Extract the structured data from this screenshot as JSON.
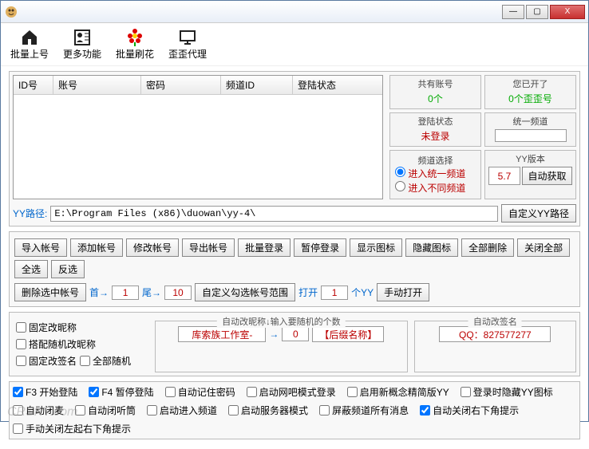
{
  "window": {
    "min": "—",
    "max": "▢",
    "close": "X"
  },
  "toolbar": [
    {
      "label": "批量上号",
      "icon": "home"
    },
    {
      "label": "更多功能",
      "icon": "user"
    },
    {
      "label": "批量刷花",
      "icon": "flower"
    },
    {
      "label": "歪歪代理",
      "icon": "monitor"
    }
  ],
  "table": {
    "cols": [
      "ID号",
      "账号",
      "密码",
      "频道ID",
      "登陆状态"
    ]
  },
  "stats": {
    "total_label": "共有账号",
    "total_val": "0个",
    "opened_label": "您已开了",
    "opened_val": "0个歪歪号",
    "login_label": "登陆状态",
    "login_val": "未登录",
    "channel_label": "统一频道",
    "channel_val": ""
  },
  "channel_select": {
    "legend": "频道选择",
    "same": "进入统一频道",
    "diff": "进入不同频道"
  },
  "version": {
    "legend": "YY版本",
    "value": "5.7",
    "btn": "自动获取"
  },
  "path": {
    "label": "YY路径:",
    "value": "E:\\Program Files (x86)\\duowan\\yy-4\\",
    "btn": "自定义YY路径"
  },
  "row_btns1": [
    "导入帐号",
    "添加帐号",
    "修改帐号",
    "导出帐号",
    "批量登录",
    "暂停登录",
    "显示图标",
    "隐藏图标",
    "全部删除",
    "关闭全部",
    "全选",
    "反选"
  ],
  "row2": {
    "del_sel": "删除选中帐号",
    "first": "首→",
    "first_v": "1",
    "last": "尾→",
    "last_v": "10",
    "range": "自定义勾选帐号范围",
    "open": "打开",
    "open_v": "1",
    "yy_unit": "个YY",
    "manual": "手动打开"
  },
  "rename_left": {
    "fix_nick": "固定改昵称",
    "match_rand": "搭配随机改昵称",
    "fix_sign": "固定改签名",
    "all_rand": "全部随机"
  },
  "rename_mid": {
    "legend": "自动改昵称↓输入要随机的个数",
    "prefix": "库索族工作室-",
    "arrow": "→",
    "count": "0",
    "suffix": "【后缀名称】"
  },
  "rename_right": {
    "legend": "自动改签名",
    "qq": "QQ：827577277"
  },
  "opts": {
    "r1": [
      "F3 开始登陆",
      "F4 暂停登陆",
      "自动记住密码",
      "启动网吧模式登录",
      "启用新概念精简版YY",
      "登录时隐藏YY图标"
    ],
    "r2": [
      "自动闭麦",
      "自动闭听筒",
      "启动进入频道",
      "启动服务器模式",
      "屏蔽频道所有消息",
      "自动关闭右下角提示"
    ],
    "r3": [
      "手动关闭左起右下角提示"
    ],
    "checked": {
      "F3 开始登陆": true,
      "F4 暂停登陆": true,
      "自动关闭右下角提示": true
    }
  },
  "watermark": "CRSKY.com"
}
